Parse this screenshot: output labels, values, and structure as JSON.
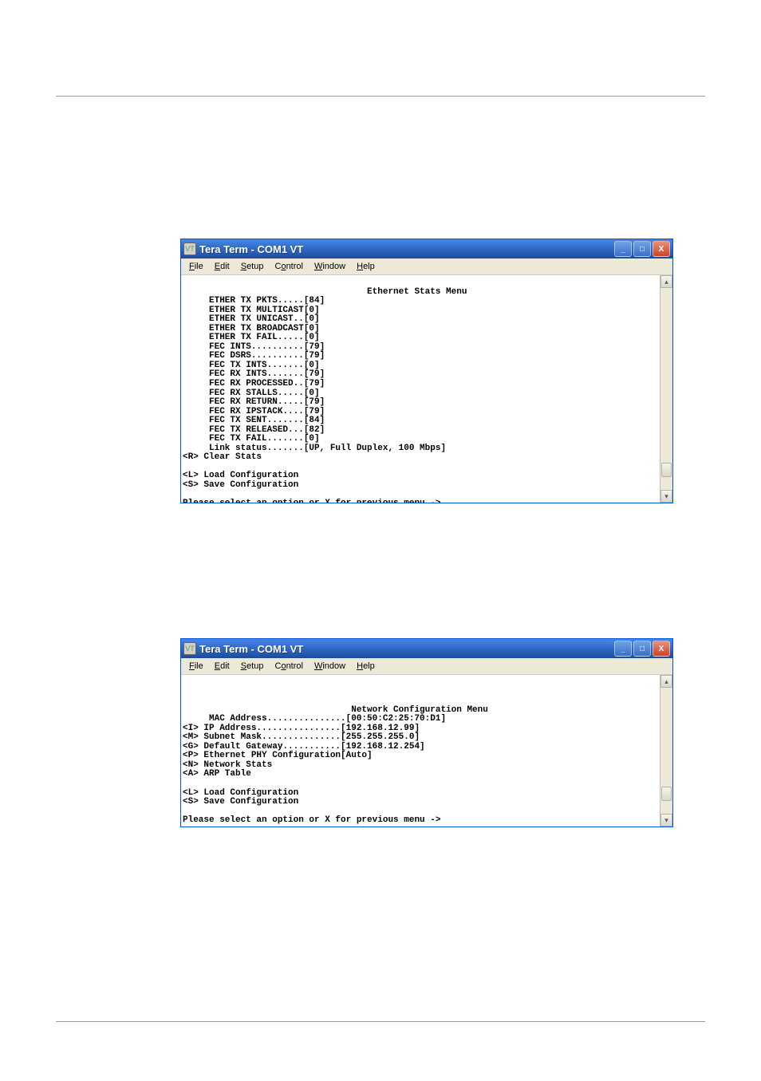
{
  "window": {
    "title": "Tera Term - COM1 VT",
    "menus": [
      "File",
      "Edit",
      "Setup",
      "Control",
      "Window",
      "Help"
    ],
    "controls": {
      "min": "_",
      "max": "□",
      "close": "X"
    }
  },
  "terminal1": {
    "heading": "Ethernet Stats Menu",
    "lines": [
      "     ETHER TX PKTS.....[84]",
      "     ETHER TX MULTICAST[0]",
      "     ETHER TX UNICAST..[0]",
      "     ETHER TX BROADCAST[0]",
      "     ETHER TX FAIL.....[0]",
      "     FEC INTS..........[79]",
      "     FEC DSRS..........[79]",
      "     FEC TX INTS.......[0]",
      "     FEC RX INTS.......[79]",
      "     FEC RX PROCESSED..[79]",
      "     FEC RX STALLS.....[0]",
      "     FEC RX RETURN.....[79]",
      "     FEC RX IPSTACK....[79]",
      "     FEC TX SENT.......[84]",
      "     FEC TX RELEASED...[82]",
      "     FEC TX FAIL.......[0]",
      "     Link status.......[UP, Full Duplex, 100 Mbps]",
      "<R> Clear Stats",
      "",
      "<L> Load Configuration",
      "<S> Save Configuration",
      "",
      "Please select an option or X for previous menu ->"
    ]
  },
  "terminal2": {
    "heading": "Network Configuration Menu",
    "lines": [
      "",
      "",
      "",
      "     MAC Address...............[00:50:C2:25:70:D1]",
      "<I> IP Address................[192.168.12.99]",
      "<M> Subnet Mask...............[255.255.255.0]",
      "<G> Default Gateway...........[192.168.12.254]",
      "<P> Ethernet PHY Configuration[Auto]",
      "<N> Network Stats",
      "<A> ARP Table",
      "",
      "<L> Load Configuration",
      "<S> Save Configuration",
      "",
      "Please select an option or X for previous menu ->"
    ]
  }
}
